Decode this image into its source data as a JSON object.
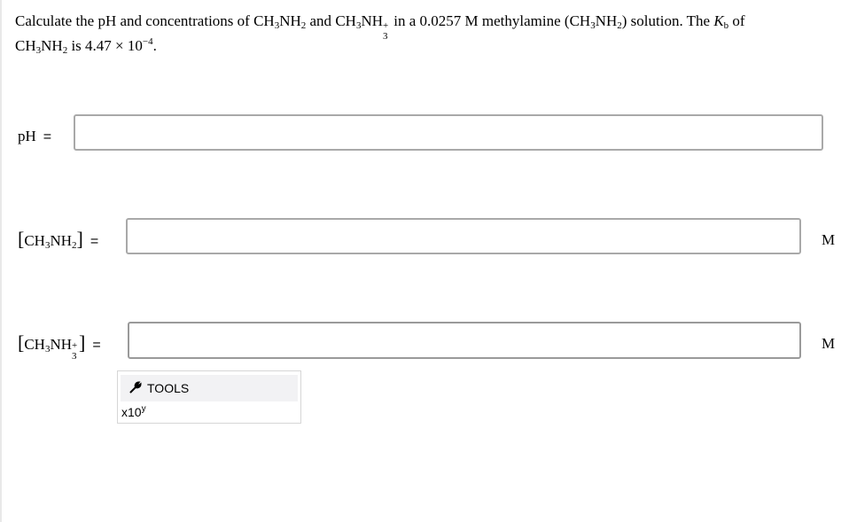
{
  "question": {
    "p1": "Calculate the pH and concentrations of ",
    "f1_a": "CH",
    "f1_s1": "3",
    "f1_b": "NH",
    "f1_s2": "2",
    "p2": " and ",
    "f2_a": "CH",
    "f2_s1": "3",
    "f2_b": "NH",
    "f2_sup": "+",
    "f2_sub": "3",
    "p3": " in a 0.0257 M methylamine (",
    "f3_a": "CH",
    "f3_s1": "3",
    "f3_b": "NH",
    "f3_s2": "2",
    "p4": ") solution. The ",
    "kb_k": "K",
    "kb_sub": "b",
    "p5": " of",
    "f4_a": "CH",
    "f4_s1": "3",
    "f4_b": "NH",
    "f4_s2": "2",
    "p6": " is 4.47 × 10",
    "exp": "−4",
    "p7": "."
  },
  "rows": {
    "ph": {
      "label": "pH",
      "eq": "=",
      "value": ""
    },
    "ch3nh2": {
      "open": "[",
      "a": "CH",
      "s1": "3",
      "b": "NH",
      "s2": "2",
      "close": "]",
      "eq": "=",
      "value": "",
      "unit": "M"
    },
    "ch3nh3": {
      "open": "[",
      "a": "CH",
      "s1": "3",
      "b": "NH",
      "sup": "+",
      "sub": "3",
      "close": "]",
      "eq": "=",
      "value": "",
      "unit": "M"
    }
  },
  "tools": {
    "label": "TOOLS",
    "icon": "wrench-icon",
    "x10_base": "x10",
    "x10_exp": "y"
  }
}
